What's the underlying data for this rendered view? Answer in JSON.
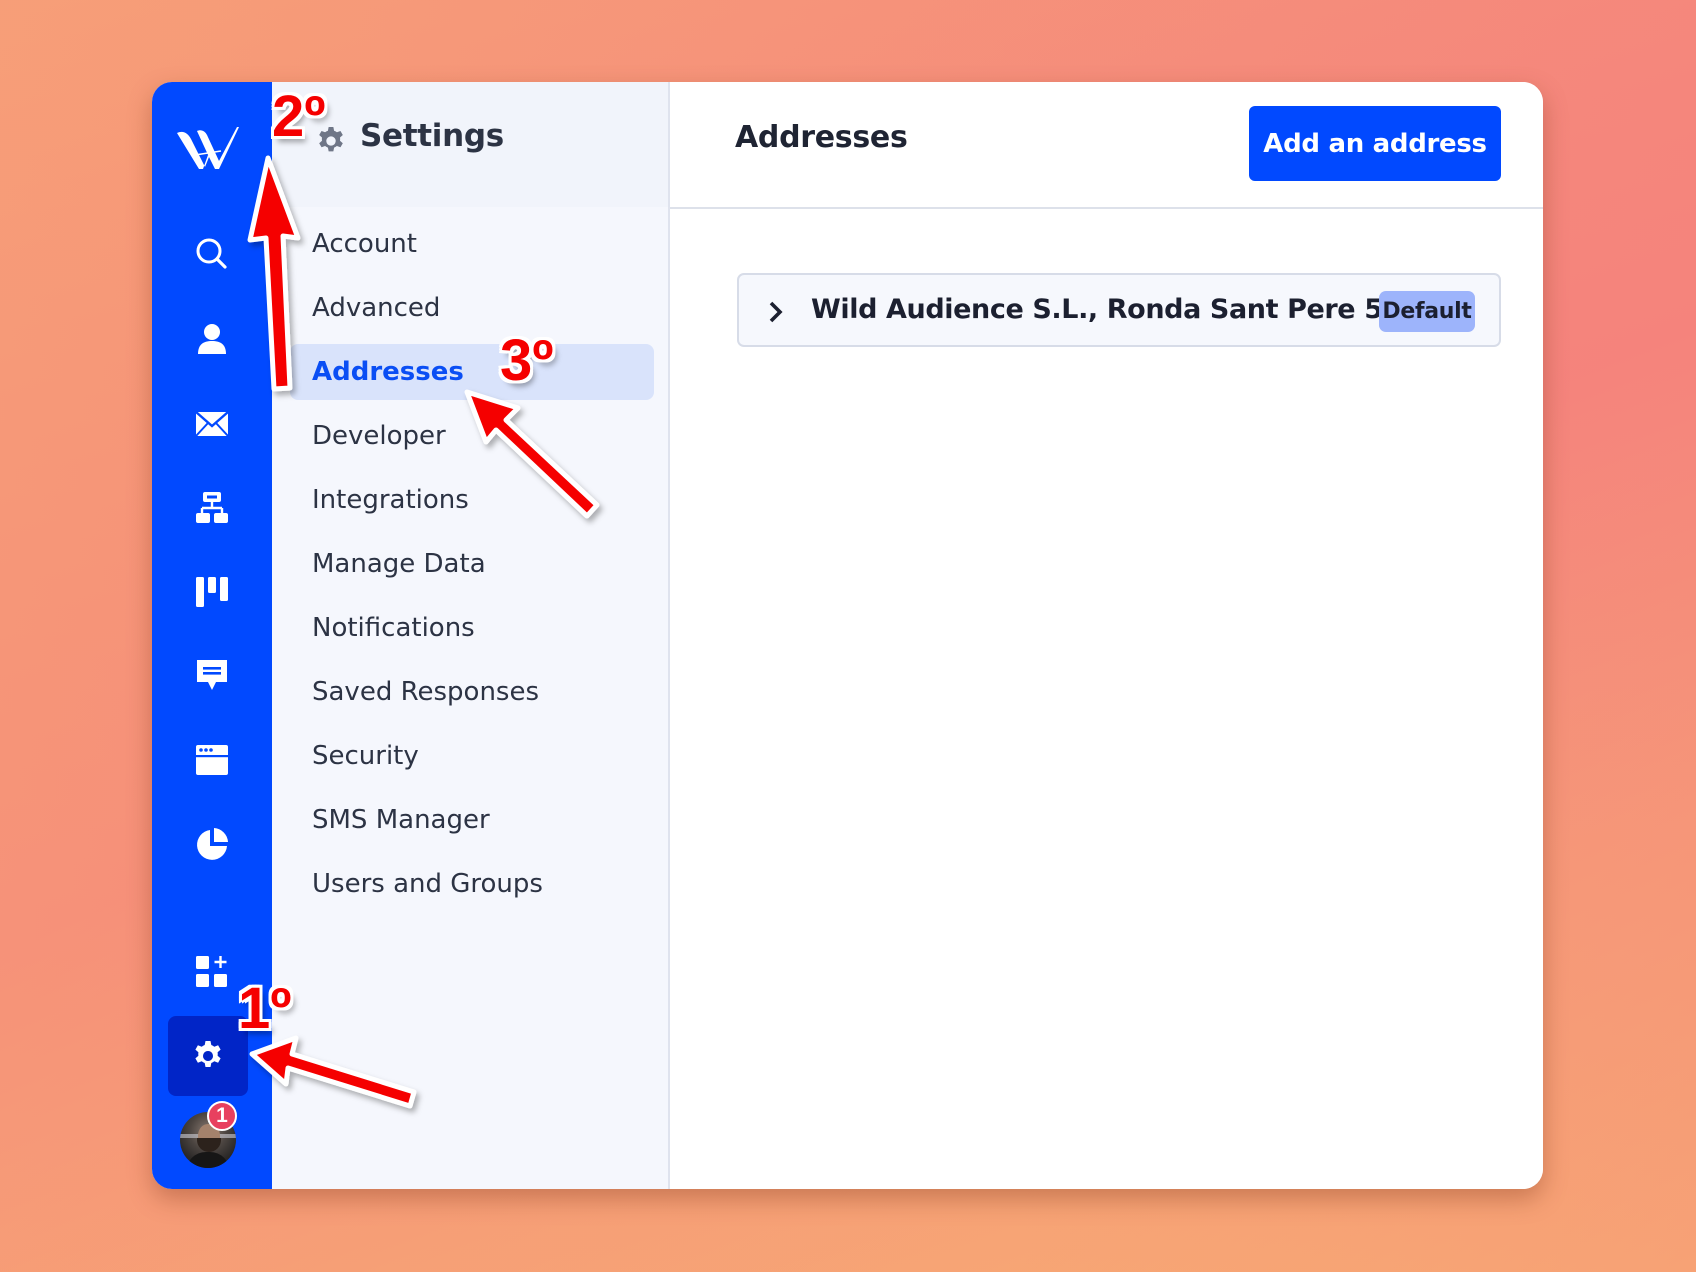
{
  "app": {
    "logo": "WA-logo",
    "rail_items": [
      {
        "name": "search",
        "icon": "search-icon"
      },
      {
        "name": "contacts",
        "icon": "user-icon"
      },
      {
        "name": "email",
        "icon": "envelope-icon"
      },
      {
        "name": "automations",
        "icon": "sitemap-icon"
      },
      {
        "name": "pipelines",
        "icon": "kanban-icon"
      },
      {
        "name": "conversations",
        "icon": "chat-bubble-icon"
      },
      {
        "name": "site",
        "icon": "browser-window-icon"
      },
      {
        "name": "reports",
        "icon": "pie-chart-icon"
      },
      {
        "name": "apps",
        "icon": "add-apps-icon"
      },
      {
        "name": "settings",
        "icon": "gear-icon",
        "active": true
      }
    ],
    "notification_count": "1"
  },
  "settings": {
    "title": "Settings",
    "nav": [
      {
        "label": "Account",
        "active": false
      },
      {
        "label": "Advanced",
        "active": false
      },
      {
        "label": "Addresses",
        "active": true
      },
      {
        "label": "Developer",
        "active": false
      },
      {
        "label": "Integrations",
        "active": false
      },
      {
        "label": "Manage Data",
        "active": false
      },
      {
        "label": "Notifications",
        "active": false
      },
      {
        "label": "Saved Responses",
        "active": false
      },
      {
        "label": "Security",
        "active": false
      },
      {
        "label": "SMS Manager",
        "active": false
      },
      {
        "label": "Users and Groups",
        "active": false
      }
    ]
  },
  "main": {
    "title": "Addresses",
    "add_button_label": "Add an address",
    "addresses": [
      {
        "text": "Wild Audience S.L., Ronda Sant Pere 52",
        "badge": "Default"
      }
    ]
  },
  "annotations": {
    "step1": "1º",
    "step2": "2º",
    "step3": "3º"
  },
  "colors": {
    "brand_blue": "#0149ff",
    "active_rail": "#0125c7",
    "active_nav_bg": "#d9e3fb",
    "active_nav_text": "#0a4ef4",
    "badge_bg": "#9db4fb",
    "annotation_red": "#f50000"
  }
}
